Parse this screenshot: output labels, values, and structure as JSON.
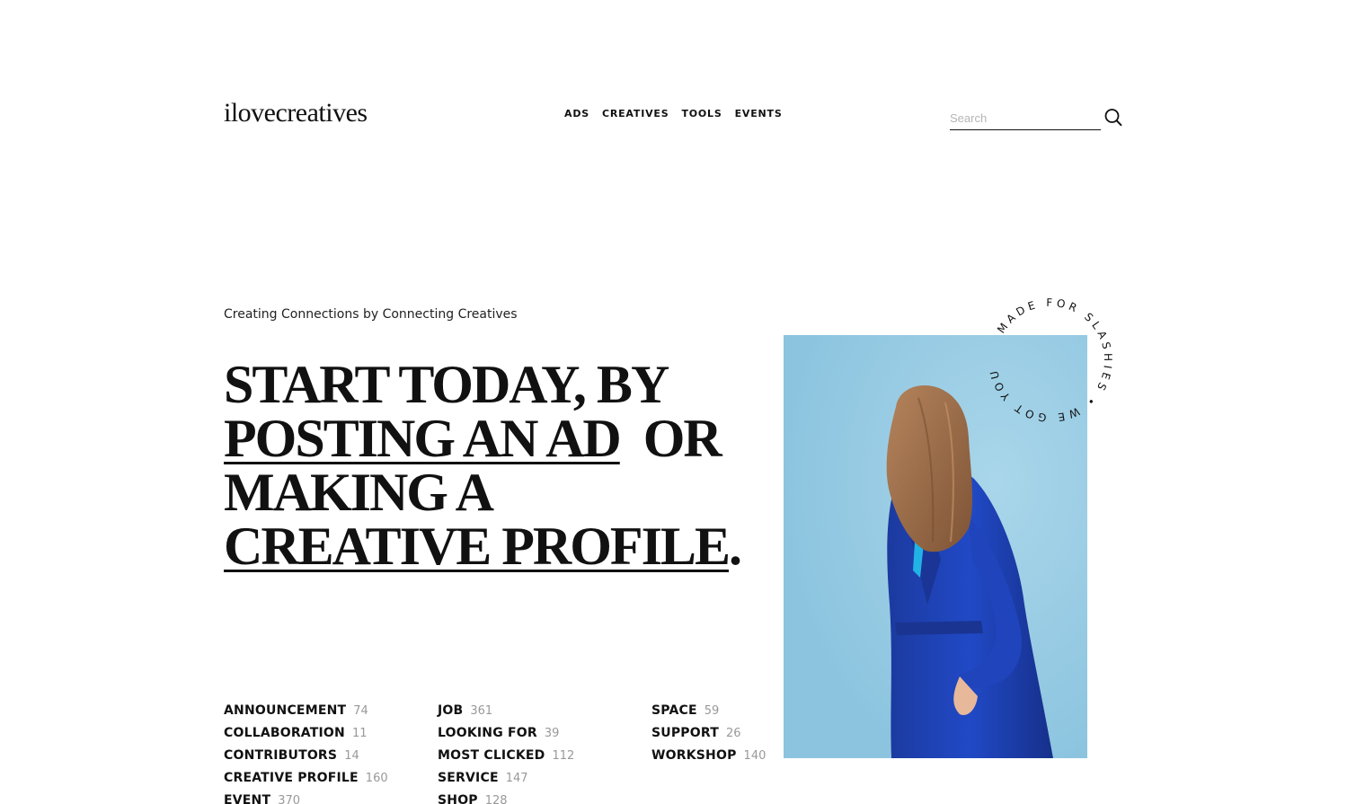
{
  "header": {
    "logo": "ilovecreatives",
    "nav": [
      "ADS",
      "CREATIVES",
      "TOOLS",
      "EVENTS"
    ],
    "search_placeholder": "Search"
  },
  "main": {
    "tagline": "Creating Connections by Connecting Creatives",
    "hero": {
      "part1": "START TODAY,  BY",
      "link1": "POSTING AN AD",
      "part2": "OR",
      "part3": "MAKING A",
      "link2": "CREATIVE PROFILE",
      "end": "."
    },
    "categories": [
      [
        {
          "label": "ANNOUNCEMENT",
          "count": "74"
        },
        {
          "label": "COLLABORATION",
          "count": "11"
        },
        {
          "label": "CONTRIBUTORS",
          "count": "14"
        },
        {
          "label": "CREATIVE PROFILE",
          "count": "160"
        },
        {
          "label": "EVENT",
          "count": "370"
        }
      ],
      [
        {
          "label": "JOB",
          "count": "361"
        },
        {
          "label": "LOOKING FOR",
          "count": "39"
        },
        {
          "label": "MOST CLICKED",
          "count": "112"
        },
        {
          "label": "SERVICE",
          "count": "147"
        },
        {
          "label": "SHOP",
          "count": "128"
        }
      ],
      [
        {
          "label": "SPACE",
          "count": "59"
        },
        {
          "label": "SUPPORT",
          "count": "26"
        },
        {
          "label": "WORKSHOP",
          "count": "140"
        }
      ]
    ],
    "badge_text": "MADE FOR SLASHIES • WE GOT YOU",
    "colors": {
      "photo_bg": "#93c9e3",
      "coat": "#1b3fb0",
      "hair": "#9a6a46"
    },
    "icons": [
      "search-icon"
    ]
  }
}
